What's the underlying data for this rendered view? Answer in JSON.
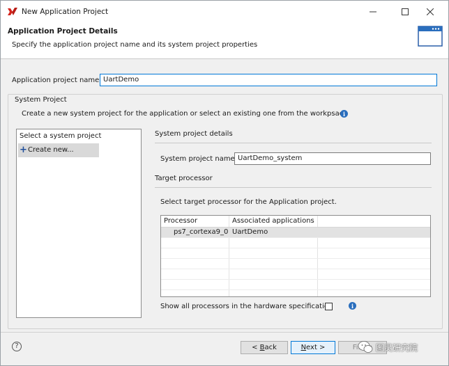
{
  "window": {
    "title": "New Application Project"
  },
  "header": {
    "title": "Application Project Details",
    "subtitle": "Specify the application project name and its system project properties"
  },
  "app_project": {
    "label": "Application project name:",
    "value": "UartDemo"
  },
  "system_project": {
    "group_title": "System Project",
    "description": "Create a new system project for the application or select an existing one from the workpsace",
    "list_header": "Select a system project",
    "list_items": [
      {
        "label": "Create new..."
      }
    ],
    "details_title": "System project details",
    "name_label": "System project name:",
    "name_value": "UartDemo_system"
  },
  "target_processor": {
    "title": "Target processor",
    "instruction": "Select target processor for the Application project.",
    "columns": [
      "Processor",
      "Associated applications"
    ],
    "rows": [
      {
        "processor": "ps7_cortexa9_0",
        "applications": "UartDemo",
        "selected": true
      }
    ],
    "show_all_label": "Show all processors in the hardware specification",
    "show_all_checked": false
  },
  "buttons": {
    "help": "?",
    "back_mnemonic": "B",
    "back_prefix": "< ",
    "back_rest": "ack",
    "next_mnemonic": "N",
    "next_rest": "ext >",
    "finish": "Finish"
  },
  "watermark": {
    "text": "图灵研究院"
  }
}
